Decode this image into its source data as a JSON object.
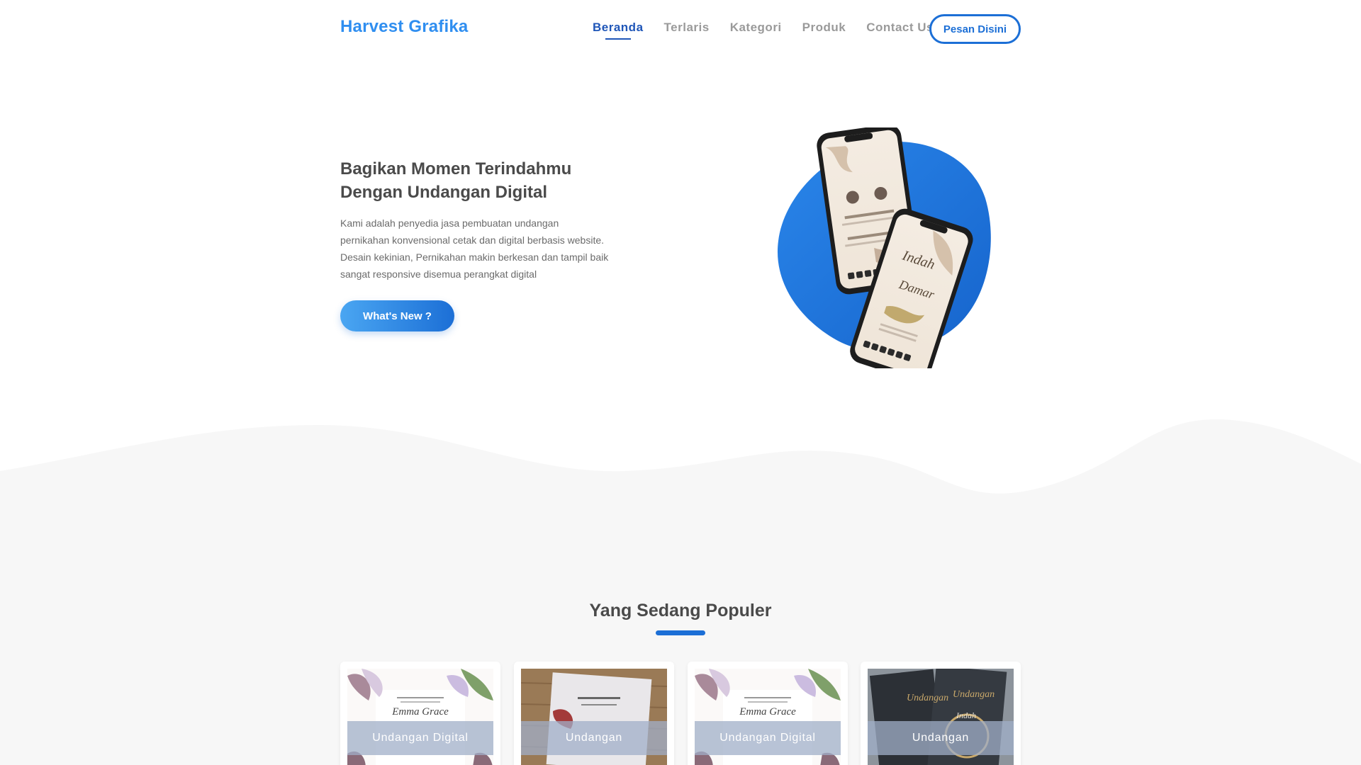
{
  "header": {
    "brand": "Harvest Grafika",
    "nav": [
      {
        "label": "Beranda",
        "active": true
      },
      {
        "label": "Terlaris",
        "active": false
      },
      {
        "label": "Kategori",
        "active": false
      },
      {
        "label": "Produk",
        "active": false
      },
      {
        "label": "Contact Us",
        "active": false
      }
    ],
    "cta_label": "Pesan Disini"
  },
  "hero": {
    "title_line1": "Bagikan Momen Terindahmu",
    "title_line2": "Dengan Undangan Digital",
    "description": "Kami adalah penyedia jasa pembuatan undangan pernikahan konvensional cetak dan digital berbasis website. Desain kekinian, Pernikahan makin berkesan dan tampil baik sangat responsive disemua perangkat digital",
    "button_label": "What's New ?",
    "image_icon": "phone-mockup-illustration"
  },
  "popular": {
    "title": "Yang Sedang Populer",
    "items": [
      {
        "label": "Undangan Digital",
        "thumb": "floral"
      },
      {
        "label": "Undangan",
        "thumb": "wood"
      },
      {
        "label": "Undangan Digital",
        "thumb": "floral"
      },
      {
        "label": "Undangan",
        "thumb": "dark"
      }
    ]
  },
  "colors": {
    "brand": "#2f8ef0",
    "primary": "#1c6fd6",
    "nav_active": "#1f56b8",
    "nav_inactive": "#9a9a9a",
    "section_bg": "#f7f7f7"
  }
}
